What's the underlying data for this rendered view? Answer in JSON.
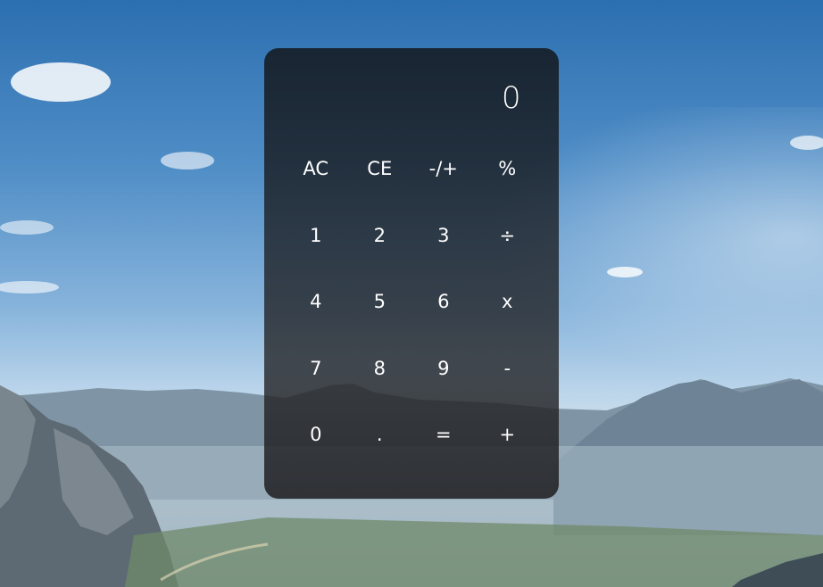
{
  "calculator": {
    "display_value": "0",
    "rows": [
      [
        "AC",
        "CE",
        "-/+",
        "%"
      ],
      [
        "1",
        "2",
        "3",
        "÷"
      ],
      [
        "4",
        "5",
        "6",
        "x"
      ],
      [
        "7",
        "8",
        "9",
        "-"
      ],
      [
        "0",
        ".",
        "=",
        "+"
      ]
    ]
  },
  "colors": {
    "panel": "#1e2228",
    "text": "#ffffff",
    "sky_top": "#2c6fb0",
    "sky_horizon": "#cddfec"
  }
}
